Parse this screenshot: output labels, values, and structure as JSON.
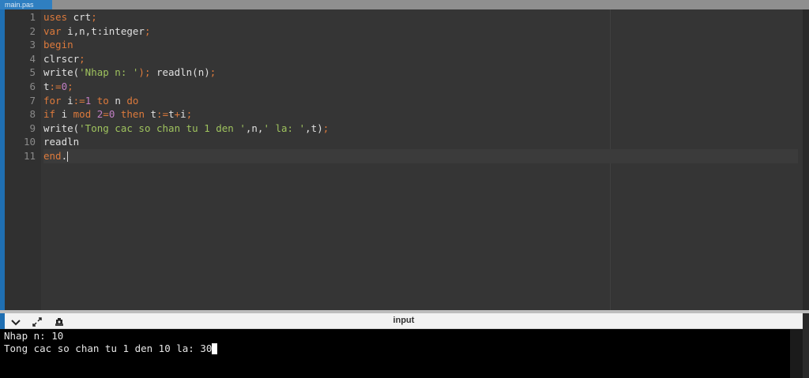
{
  "tab": {
    "filename": "main.pas"
  },
  "editor": {
    "line_numbers": [
      "1",
      "2",
      "3",
      "4",
      "5",
      "6",
      "7",
      "8",
      "9",
      "10",
      "11"
    ],
    "lines": [
      [
        {
          "t": "uses",
          "c": "kw"
        },
        {
          "t": " crt",
          "c": "id"
        },
        {
          "t": ";",
          "c": "kw"
        }
      ],
      [
        {
          "t": "var",
          "c": "kw"
        },
        {
          "t": " i,n,t:integer",
          "c": "id"
        },
        {
          "t": ";",
          "c": "kw"
        }
      ],
      [
        {
          "t": "begin",
          "c": "kw"
        }
      ],
      [
        {
          "t": "clrscr",
          "c": "id"
        },
        {
          "t": ";",
          "c": "kw"
        }
      ],
      [
        {
          "t": "write(",
          "c": "id"
        },
        {
          "t": "'Nhap n: '",
          "c": "str"
        },
        {
          "t": ");",
          "c": "kw"
        },
        {
          "t": " readln(n)",
          "c": "id"
        },
        {
          "t": ";",
          "c": "kw"
        }
      ],
      [
        {
          "t": "t",
          "c": "id"
        },
        {
          "t": ":=",
          "c": "kw"
        },
        {
          "t": "0",
          "c": "num"
        },
        {
          "t": ";",
          "c": "kw"
        }
      ],
      [
        {
          "t": "for",
          "c": "kw"
        },
        {
          "t": " i",
          "c": "id"
        },
        {
          "t": ":=",
          "c": "kw"
        },
        {
          "t": "1",
          "c": "num"
        },
        {
          "t": " to",
          "c": "kw"
        },
        {
          "t": " n ",
          "c": "id"
        },
        {
          "t": "do",
          "c": "kw"
        }
      ],
      [
        {
          "t": "if",
          "c": "kw"
        },
        {
          "t": " i ",
          "c": "id"
        },
        {
          "t": "mod",
          "c": "kw"
        },
        {
          "t": " ",
          "c": "id"
        },
        {
          "t": "2",
          "c": "num"
        },
        {
          "t": "=",
          "c": "kw"
        },
        {
          "t": "0",
          "c": "num"
        },
        {
          "t": " then",
          "c": "kw"
        },
        {
          "t": " t",
          "c": "id"
        },
        {
          "t": ":=",
          "c": "kw"
        },
        {
          "t": "t",
          "c": "id"
        },
        {
          "t": "+",
          "c": "kw"
        },
        {
          "t": "i",
          "c": "id"
        },
        {
          "t": ";",
          "c": "kw"
        }
      ],
      [
        {
          "t": "write(",
          "c": "id"
        },
        {
          "t": "'Tong cac so chan tu 1 den '",
          "c": "str"
        },
        {
          "t": ",n,",
          "c": "id"
        },
        {
          "t": "' la: '",
          "c": "str"
        },
        {
          "t": ",t)",
          "c": "id"
        },
        {
          "t": ";",
          "c": "kw"
        }
      ],
      [
        {
          "t": "readln",
          "c": "id"
        }
      ],
      [
        {
          "t": "end",
          "c": "kw"
        },
        {
          "t": ".",
          "c": "id"
        }
      ]
    ],
    "active_line": 10
  },
  "panel": {
    "title": "input",
    "icons": [
      "chevron-down-icon",
      "expand-icon",
      "settings-icon"
    ]
  },
  "console": {
    "lines": [
      "Nhap n: 10",
      "Tong cac so chan tu 1 den 10 la: 30"
    ]
  },
  "colors": {
    "editor_bg": "#353535",
    "keyword": "#dd7a3c",
    "string": "#9fc35e",
    "number": "#c17fc4",
    "tab_bg": "#2f7fc1",
    "console_bg": "#000000"
  }
}
